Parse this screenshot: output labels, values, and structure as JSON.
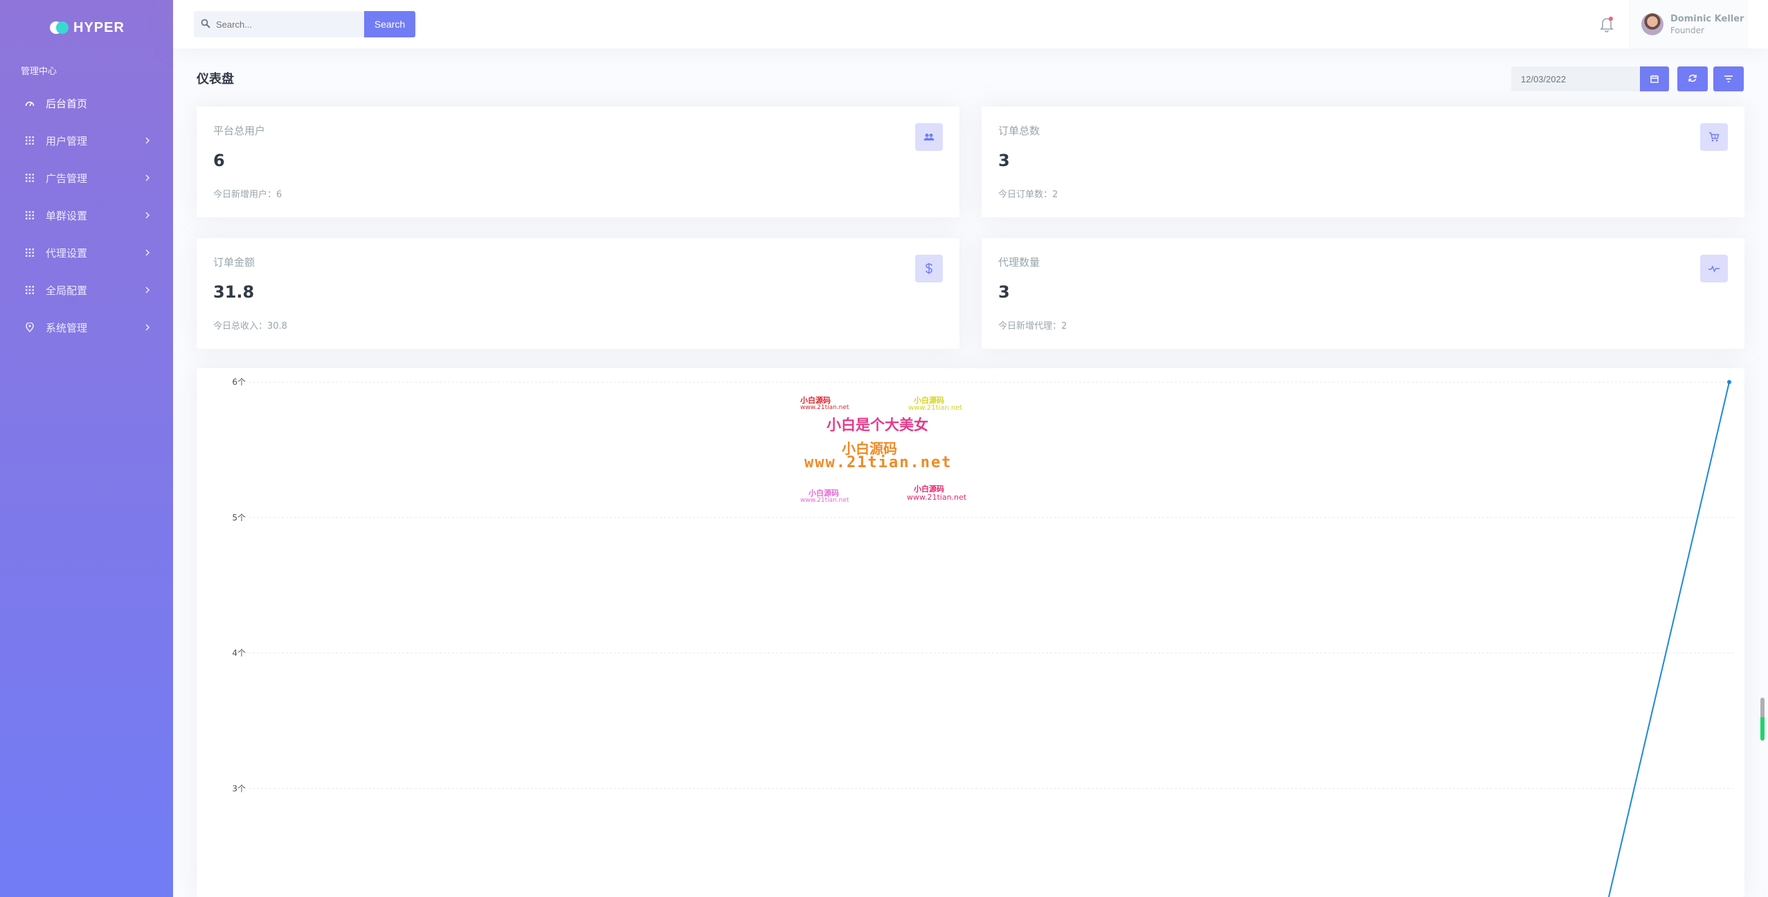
{
  "sidebar": {
    "logo_text": "HYPER",
    "section_title": "管理中心",
    "items": [
      {
        "label": "后台首页",
        "icon": "dashboard-icon"
      },
      {
        "label": "用户管理",
        "icon": "grid-icon"
      },
      {
        "label": "广告管理",
        "icon": "grid-icon"
      },
      {
        "label": "单群设置",
        "icon": "grid-icon"
      },
      {
        "label": "代理设置",
        "icon": "grid-icon"
      },
      {
        "label": "全局配置",
        "icon": "grid-icon"
      },
      {
        "label": "系统管理",
        "icon": "map-pin-icon"
      }
    ]
  },
  "topbar": {
    "search_placeholder": "Search...",
    "search_button": "Search",
    "user_name": "Dominic Keller",
    "user_role": "Founder"
  },
  "page": {
    "title": "仪表盘",
    "date": "12/03/2022"
  },
  "stats": [
    {
      "label": "平台总用户",
      "value": "6",
      "sub": "今日新增用户：6",
      "icon": "users-icon"
    },
    {
      "label": "订单总数",
      "value": "3",
      "sub": "今日订单数：2",
      "icon": "cart-icon"
    },
    {
      "label": "订单金额",
      "value": "31.8",
      "sub": "今日总收入：30.8",
      "icon": "dollar-icon"
    },
    {
      "label": "代理数量",
      "value": "3",
      "sub": "今日新增代理：2",
      "icon": "pulse-icon"
    }
  ],
  "chart_data": {
    "type": "line",
    "title": "",
    "xlabel": "",
    "ylabel": "",
    "ylim": [
      2.2,
      6
    ],
    "y_ticks": [
      "3个",
      "4个",
      "5个",
      "6个"
    ],
    "y_tick_values": [
      3,
      4,
      5,
      6
    ],
    "grid": true,
    "series": [
      {
        "values": [
          2.2,
          6
        ],
        "color": "#1e88d9"
      }
    ]
  },
  "watermark": {
    "lines": [
      "小白源码",
      "www.21tian.net",
      "小白源码",
      "www.21tian.net",
      "小白是个大美女",
      "小白源码",
      "www.21tian.net",
      "小白源码",
      "www.21tian.net",
      "小白源码",
      "www.21tian.net"
    ]
  },
  "colors": {
    "primary": "#727cf5",
    "sidebar_top": "#8f75da",
    "accent_cyan": "#39d9d2",
    "line": "#1e88d9"
  }
}
